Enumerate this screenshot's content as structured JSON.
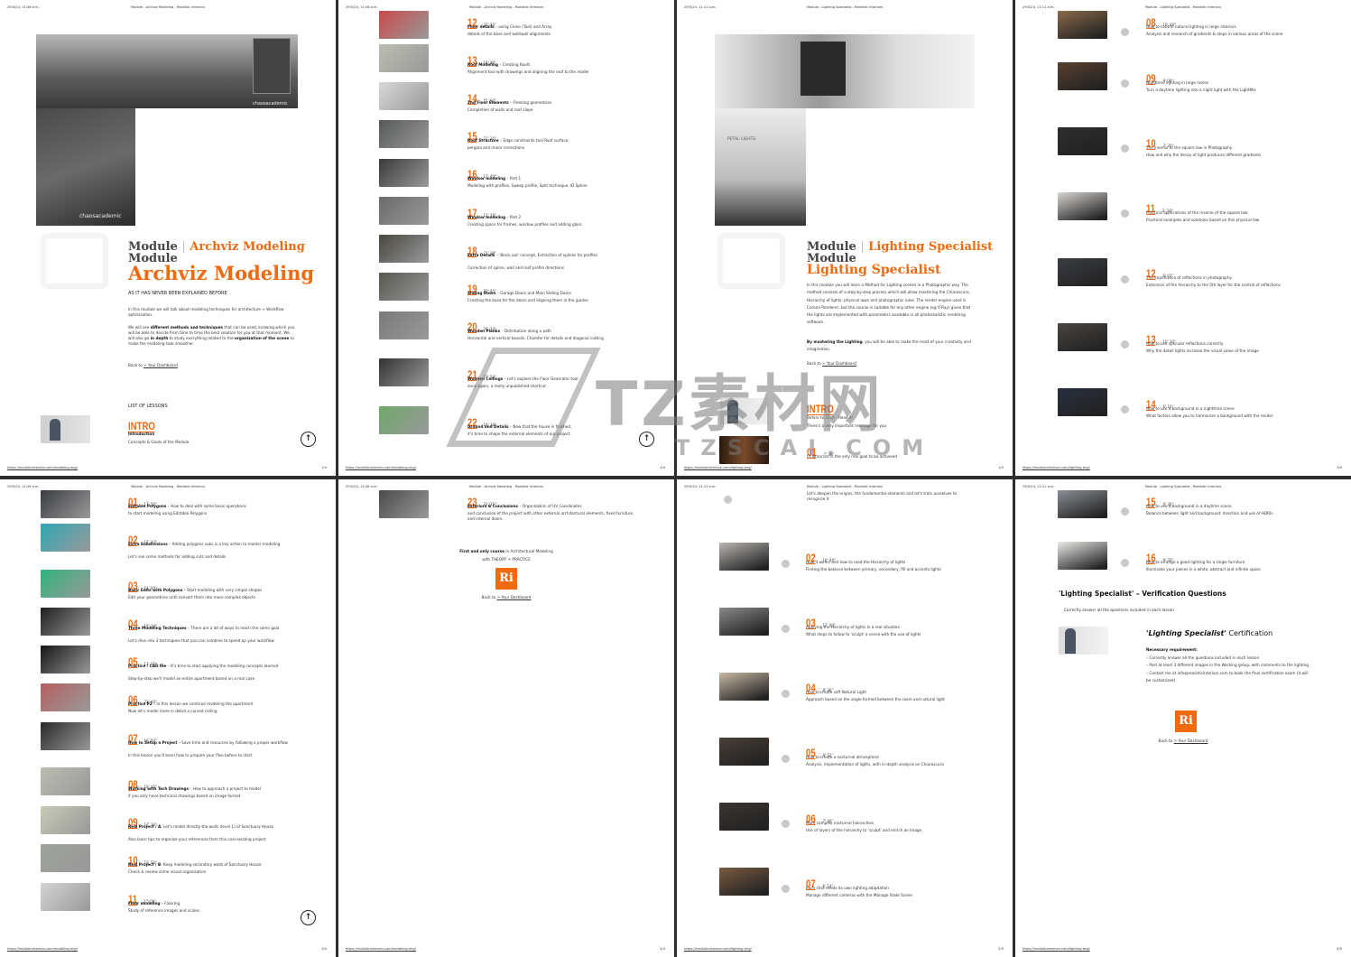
{
  "accent": "#f26a10",
  "watermark": {
    "cn": "TZ素材网",
    "en": "TZSCAI.COM"
  },
  "pages": [
    {
      "header_date": "29/5/24, 11:46 a.m.",
      "header_title": "Module - Archviz Modeling - Realistic Interiors",
      "footer_url": "https://realisticinteriors.com/modeling-eng/",
      "page_num": "1/4",
      "title_line": "Module",
      "title_accent": "Archviz Modeling",
      "title_module": "Module",
      "title_big": "Archviz Modeling",
      "tagline": "AS IT HAS NEVER BEEN EXPLAINED BEFORE",
      "para1": "In this module we will talk about modeling techniques for architecture + Workflow optimization.",
      "para2_a": "We will see ",
      "para2_b": "different methods and techniques",
      "para2_c": " that can be used, knowing which you will be able to decide from time to time the best solution for you at that moment. We will also go ",
      "para2_d": "in depth",
      "para2_e": " to study everything related to the ",
      "para2_f": "organization of the scene",
      "para2_g": " to make the modeling task smoother.",
      "back_prefix": "Back to",
      "back_link": "> Your Dashboard",
      "list_label": "LIST OF LESSONS",
      "intro_num": "INTRO",
      "intro_title": "Introduction",
      "intro_desc": "Concepts & Goals of the Module",
      "brand": "chaosacademic"
    },
    {
      "header_date": "29/5/24, 11:46 a.m.",
      "header_title": "Module - Archviz Modeling - Realistic Interiors",
      "footer_url": "https://realisticinteriors.com/modeling-eng/",
      "page_num": "2/4",
      "lessons": [
        {
          "num": "01",
          "dur": "17' 50''",
          "title": "Editable Polygons",
          "rest": " – How to deal with some basic operations",
          "desc": "to start modeling using Editable Polygons",
          "thumb": "#3a3d42"
        },
        {
          "num": "02",
          "dur": "11' 32''",
          "title": "Extra Subdivisions",
          "rest": " – Adding polygons subs is a key action to master modeling",
          "desc": "Let's see some methods for adding cuts and details",
          "thumb": "#2fa7b5"
        },
        {
          "num": "03",
          "dur": "11' 00''",
          "title": "Basic Edits with Polygons",
          "rest": " – Start modeling with very simple shapes",
          "desc": "Edit your geometries until convert them into more complex objects",
          "thumb": "#2fb37a"
        },
        {
          "num": "04",
          "dur": "19' 30''",
          "title": "Three Modeling Techniques",
          "rest": " – There are a lot of ways to reach the same goal",
          "desc": "Let's dive into 3 techniques that you can combine to speed up your workflow",
          "thumb": "#1e1e1e"
        },
        {
          "num": "05",
          "dur": "13' 15''",
          "title": "Practice / CAD file",
          "rest": " – It's time to start applying the modeling concepts learned",
          "desc": "Step-by-step we'll model an entire apartment based on a real case",
          "thumb": "#151515"
        },
        {
          "num": "06",
          "dur": "22' 00''",
          "title": "Practice P2",
          "rest": " – In this lesson we continue modeling the apartment",
          "desc": "Now let's model more in detail a curved ceiling",
          "thumb": "#b56060"
        },
        {
          "num": "07",
          "dur": "16' 00''",
          "title": "How to Setup a Project",
          "rest": " – Save time and resources by following a proper workflow",
          "desc": "In this lesson you'll learn how to prepare your files before to start",
          "thumb": "#2a2a2a"
        },
        {
          "num": "08",
          "dur": "19' 15''",
          "title": "Working with Tech Drawings",
          "rest": " – How to approach a project to model",
          "desc": "if you only have technical drawings based on image format",
          "thumb": "#b9bdb0"
        },
        {
          "num": "09",
          "dur": "17' 30''",
          "title": "Real Project / A",
          "rest": ": Let's model directly the walls (level 1) of Sanctuary House",
          "desc": "Also learn tips to organize your references from this cool existing project",
          "thumb": "#c7cbb6"
        },
        {
          "num": "10",
          "dur": "13' 50''",
          "title": "Real Project / B",
          "rest": ": Keep modeling secondary walls of Sanctuary House",
          "desc": "Check & review some visual organization",
          "thumb": "#9ea39a"
        },
        {
          "num": "11",
          "dur": "27' 00''",
          "title": "Floor modeling",
          "rest": " – Flooring",
          "desc": "Study of reference images and scales",
          "thumb": "#d4d4d4"
        }
      ]
    },
    {
      "header_date": "29/5/24, 11:46 a.m.",
      "header_title": "Module - Archviz Modeling - Realistic Interiors",
      "footer_url": "https://realisticinteriors.com/modeling-eng/",
      "page_num": "3/4",
      "lessons": [
        {
          "num": "12",
          "dur": "22' 30''",
          "title": "Floor details",
          "rest": " – using Clone (Tool) and Array",
          "desc": "details of the base and wall/wall alignments",
          "thumb": "#c94a4a"
        },
        {
          "num": "13",
          "dur": "16' 30''",
          "title": "Roof Modeling",
          "rest": " – Creating Roofs",
          "desc": "Alignment tool with drawings and aligning the roof to the model",
          "thumb": "#bdbdb0"
        },
        {
          "num": "14",
          "dur": "15' 50''",
          "title": "2nd Floor Elements",
          "rest": " – Freezing geometries",
          "desc": "Completion of walls and roof slope",
          "thumb": "#d8d8d8"
        },
        {
          "num": "15",
          "dur": "22' 16''",
          "title": "Roof Structure",
          "rest": " – Edge constraints tool Roof surface,",
          "desc": "pergola and minor corrections",
          "thumb": "#555a55"
        },
        {
          "num": "16",
          "dur": "17' 40''",
          "title": "Window modeling",
          "rest": " – Part 1",
          "desc": "Modeling with profiles, Sweep profile, Split technique, ID Spline",
          "thumb": "#3a3a3a"
        },
        {
          "num": "17",
          "dur": "12' 30''",
          "title": "Window modeling",
          "rest": " – Part 2",
          "desc": "Creating space for frames, window profiles and adding glass",
          "thumb": "#6b6b6b"
        },
        {
          "num": "18",
          "dur": "21' 18''",
          "title": "Extra Details",
          "rest": " – 'Block out' concept, Extraction of splines for profiles",
          "desc": "Correction of spline, wall and roof profile directions",
          "thumb": "#4a4640"
        },
        {
          "num": "19",
          "dur": "22' 45''",
          "title": "Sliding Doors",
          "rest": " – Garage Doors and Main Sliding Doors",
          "desc": "Creating the base for the doors and aligning them in the guides",
          "thumb": "#55584f"
        },
        {
          "num": "20",
          "dur": "35' 30''",
          "title": "Wooden Planks",
          "rest": " – Distribution along a path",
          "desc": "Horizontal and vertical boards, Chamfer for details and diagonal cutting",
          "thumb": "#7a7a7a"
        },
        {
          "num": "21",
          "dur": "27' 53''",
          "title": "Wooden Ceilings",
          "rest": " – Let's explore the Floor Generator tool",
          "desc": "once again, a really unpublished shortcut",
          "thumb": "#333"
        },
        {
          "num": "22",
          "dur": "18' 30''",
          "title": "Ground and Details",
          "rest": " – Now that the house is finished,",
          "desc": "it's time to shape the external elements of our project.",
          "thumb": "#6fa86a"
        }
      ]
    },
    {
      "header_date": "29/5/24, 11:46 a.m.",
      "header_title": "Module - Archviz Modeling - Realistic Interiors",
      "footer_url": "https://realisticinteriors.com/modeling-eng/",
      "page_num": "4/4",
      "lessons": [
        {
          "num": "23",
          "dur": "22' 35''",
          "title": "Exteriors & Conclusions",
          "rest": " – Organization of UV Coordinates",
          "desc": "and conclusion of the project with other external architectural elements, fixed furniture and internal doors.",
          "thumb": "#4a4a4a"
        }
      ],
      "promo_a": "First and only course",
      "promo_b": " in Architectural Modeling",
      "promo_c": "with THEORY + PRACTICE",
      "logo": "Ri",
      "back_prefix": "Back to",
      "back_link": "> Your Dashboard"
    },
    {
      "header_date": "29/5/24, 11:11 a.m.",
      "header_title": "Module - Lighting Specialist - Realistic Interiors",
      "footer_url": "https://realisticinteriors.com/lighting-eng/",
      "page_num": "1/5",
      "title_line": "Module",
      "title_accent": "Lighting Specialist",
      "title_module": "Module",
      "title_big": "Lighting Specialist",
      "p1": "In this module you will learn a Method for Lighting scenes in a Photographic way. The method consists of a step-by-step process which will allow mastering the Chiaroscuro, Hierarchy of lights, physical laws and photographic rules. The render engine used is Corona Renderer, but the course is suitable for any other engine (eg V-Ray) given that the lights are implemented with parameters available in all photorealistic rendering software.",
      "p2_a": "By mastering the Lighting",
      "p2_b": ", you will be able to make the most of your creativity and imagination.",
      "back_prefix": "Back to",
      "back_link": "> Your Dashboard",
      "intro_num": "INTRO",
      "intro_title": "Before to start – Read it!",
      "intro_desc": "There's a very important message for you",
      "l01_num": "01",
      "l01_dur": "7' 30''",
      "l01_desc": "Chiaroscuro is the only real goal to be achieved",
      "photo_label": "PETAL LIGHTS"
    },
    {
      "header_date": "29/5/24, 11:11 a.m.",
      "header_title": "Module - Lighting Specialist - Realistic Interiors",
      "footer_url": "https://realisticinteriors.com/lighting-eng/",
      "page_num": "2/5",
      "carry": "Let's deepen the origins, the fundamental elements and let's train ourselves to recognize it",
      "lessons": [
        {
          "num": "02",
          "dur": "10' 40''",
          "title": "How it works and how to read the Hierarchy of lights",
          "desc": "Finding the balance between primary, secondary, fill and accents lights",
          "thumb": "#b8b4b0"
        },
        {
          "num": "03",
          "dur": "12' 00''",
          "title": "Applying the Hierarchy of lights in a real situation",
          "desc": "What steps to follow to 'sculpt' a scene with the use of lights",
          "thumb": "#8a8a8a"
        },
        {
          "num": "04",
          "dur": "8' 36''",
          "title": "How to create soft Natural Light",
          "desc": "Approach based on the angle formed between the room and natural light",
          "thumb": "#c9b8a4"
        },
        {
          "num": "05",
          "dur": "8' 52''",
          "title": "How to create a nocturnal atmosphere",
          "desc": "Analysis, implementation of lights, with in-depth analysis on Chiaroscuro",
          "thumb": "#4a3f36"
        },
        {
          "num": "06",
          "dur": "7' 40''",
          "title": "More complex nocturnal hierarchies",
          "desc": "Use of layers of the hierarchy to 'sculpt' and enrich an image",
          "thumb": "#3b3530"
        },
        {
          "num": "07",
          "dur": "6' 14''",
          "title": "Each shot needs its own lighting adaptation",
          "desc": "Manage different cameras with the Manage State Scene",
          "thumb": "#7a5a40"
        }
      ]
    },
    {
      "header_date": "29/5/24, 11:11 a.m.",
      "header_title": "Module - Lighting Specialist - Realistic Interiors",
      "footer_url": "https://realisticinteriors.com/lighting-eng/",
      "page_num": "3/5",
      "lessons": [
        {
          "num": "08",
          "dur": "10' 40''",
          "title": "How to control natural lighting in large interiors",
          "desc": "Analysis and research of gradients & steps in various areas of the scene",
          "thumb": "#8a6a4a"
        },
        {
          "num": "09",
          "dur": "9' 00''",
          "title": "Nighttime lighting in large rooms",
          "desc": "Turn a daytime lighting into a night light with the LightMix",
          "thumb": "#5a4030"
        },
        {
          "num": "10",
          "dur": "7' 30''",
          "title": "The inverse of the square law in Photography",
          "desc": "How and why the decay of light produces different gradients",
          "thumb": "#2e2e2e"
        },
        {
          "num": "11",
          "dur": "3' 10''",
          "title": "Practical applications of the inverse of the square law",
          "desc": "Practical examples and solutions based on this physical law",
          "thumb": "#d8d4d0"
        },
        {
          "num": "12",
          "dur": "6' 03''",
          "title": "The importance of reflections in photography",
          "desc": "Extension of the hierarchy to the 5th layer for the control of reflections",
          "thumb": "#3a3e44"
        },
        {
          "num": "13",
          "dur": "10' 30''",
          "title": "How to use specular reflections correctly",
          "desc": "Why the detail lights increase the visual value of the image",
          "thumb": "#4a4540"
        },
        {
          "num": "14",
          "dur": "6' 10''",
          "title": "How to use a background in a nighttime scene",
          "desc": "What factors allow you to harmonize a background with the render",
          "thumb": "#283040"
        }
      ]
    },
    {
      "header_date": "29/5/24, 11:11 a.m.",
      "header_title": "Module - Lighting Specialist - Realistic Interiors",
      "footer_url": "https://realisticinteriors.com/lighting-eng/",
      "page_num": "4/5",
      "lessons": [
        {
          "num": "15",
          "dur": "9' 30''",
          "title": "How to use a background in a daytime scene",
          "desc": "Balance between light and background: direction and use of HDRIs",
          "thumb": "#8a8f96"
        },
        {
          "num": "16",
          "dur": "9' 20''",
          "title": "How to arrange a good lighting for a single furniture",
          "desc": "Illuminate your pieces in a white, abstract and infinite space",
          "thumb": "#ecebe8"
        }
      ],
      "verif_title": "'Lighting Specialist' – Verification Questions",
      "verif_sub": "Correctly answer all the questions included in each lesson",
      "cert_italic": "'Lighting Specialist'",
      "cert_rest": " Certification",
      "req_title": "Necessary requirement:",
      "req": [
        "– Correctly answer all the questions included in each lesson",
        "– Post at least 3 different images in the Working group, with comments to the lighting",
        "– Contact me at info@realisticinteriors.com to book the final certification exam (it will be customized)"
      ],
      "logo": "Ri",
      "back_prefix": "Back to",
      "back_link": "> Your Dashboard"
    }
  ]
}
